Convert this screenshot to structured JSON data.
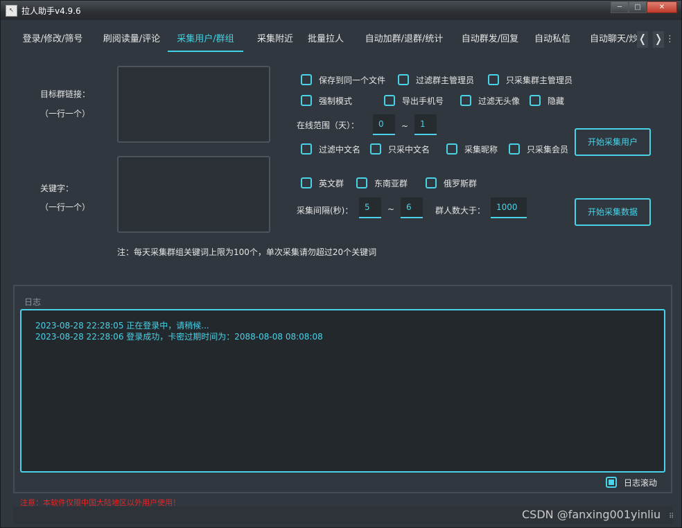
{
  "window": {
    "title": "拉人助手v4.9.6",
    "icon_glyph": "↖",
    "minimize": "─",
    "maximize": "□",
    "close": "✕"
  },
  "tabs": [
    {
      "label": "登录/修改/筛号"
    },
    {
      "label": "刷阅读量/评论"
    },
    {
      "label": "采集用户/群组",
      "active": true
    },
    {
      "label": "采集附近"
    },
    {
      "label": "批量拉人"
    },
    {
      "label": "自动加群/退群/统计"
    },
    {
      "label": "自动群发/回复"
    },
    {
      "label": "自动私信"
    },
    {
      "label": "自动聊天/炒"
    }
  ],
  "tab_nav": {
    "prev": "❬",
    "next": "❭",
    "more": "⋮"
  },
  "form": {
    "target_group_label": "目标群链接：",
    "target_group_hint": "（一行一个）",
    "target_group_value": "",
    "keywords_label": "关键字：",
    "keywords_hint": "（一行一个）",
    "keywords_value": "",
    "note": "注：每天采集群组关键词上限为100个，单次采集请勿超过20个关键词"
  },
  "options": {
    "save_same_file": "保存到同一个文件",
    "filter_group_admins": "过滤群主管理员",
    "only_group_admins": "只采集群主管理员",
    "force_mode": "强制模式",
    "export_phone": "导出手机号",
    "filter_no_avatar": "过滤无头像",
    "hide": "隐藏",
    "online_range_label": "在线范围（天）：",
    "online_from": "0",
    "online_to": "1",
    "range_sep": "~",
    "filter_chinese_name": "过滤中文名",
    "only_chinese_name": "只采中文名",
    "collect_nickname": "采集昵称",
    "only_members": "只采集会员",
    "english_group": "英文群",
    "sea_group": "东南亚群",
    "russia_group": "俄罗斯群",
    "interval_label": "采集间隔(秒)：",
    "interval_from": "5",
    "interval_to": "6",
    "group_size_label": "群人数大于：",
    "group_size_value": "1000",
    "start_collect_users": "开始采集用户",
    "start_collect_data": "开始采集数据"
  },
  "log": {
    "title": "日志",
    "lines": [
      "2023-08-28 22:28:05 正在登录中，请稍候...",
      "2023-08-28 22:28:06 登录成功，卡密过期时间为：2088-08-08 08:08:08"
    ],
    "auto_scroll_label": "日志滚动",
    "auto_scroll_checked": true
  },
  "footer": {
    "notice": "注意：本软件仅限中国大陆地区以外用户使用！",
    "watermark": "CSDN @fanxing001yinliu"
  },
  "colors": {
    "accent": "#4ad3e8",
    "background": "#30373e",
    "warning": "#e22222"
  }
}
